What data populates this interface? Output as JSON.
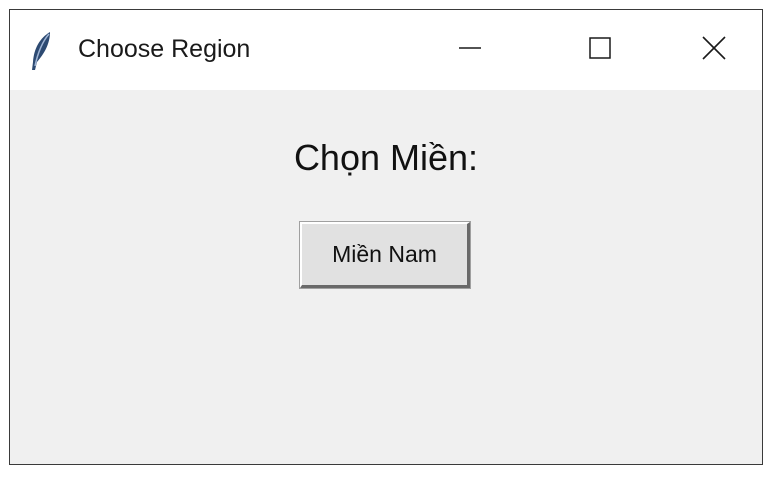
{
  "window": {
    "title": "Choose Region",
    "icon": "feather-icon",
    "controls": {
      "minimize": "minimize-icon",
      "maximize": "maximize-icon",
      "close": "close-icon"
    }
  },
  "content": {
    "heading": "Chọn Miền:",
    "buttons": [
      {
        "label": "Miền Nam"
      }
    ]
  }
}
